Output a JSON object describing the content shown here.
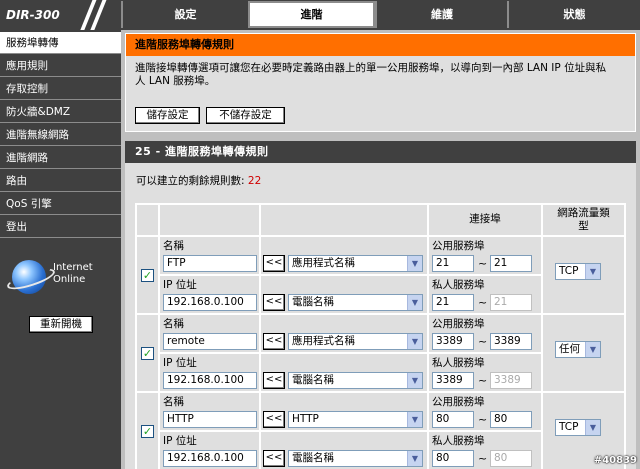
{
  "app": {
    "logo": "DIR-300"
  },
  "nav": {
    "tabs": [
      {
        "label": "設定"
      },
      {
        "label": "進階"
      },
      {
        "label": "維護"
      },
      {
        "label": "狀態"
      }
    ]
  },
  "sidebar": {
    "items": [
      {
        "label": "服務埠轉傳"
      },
      {
        "label": "應用規則"
      },
      {
        "label": "存取控制"
      },
      {
        "label": "防火牆&DMZ"
      },
      {
        "label": "進階無線網路"
      },
      {
        "label": "進階網路"
      },
      {
        "label": "路由"
      },
      {
        "label": "QoS 引擎"
      },
      {
        "label": "登出"
      }
    ],
    "internet_status_line1": "Internet",
    "internet_status_line2": "Online",
    "reboot_label": "重新開機"
  },
  "intro": {
    "title": "進階服務埠轉傳規則",
    "description": "進階接埠轉傳選項可讓您在必要時定義路由器上的單一公用服務埠，以導向到一內部 LAN IP 位址與私人 LAN 服務埠。",
    "save_label": "儲存設定",
    "dont_save_label": "不儲存設定"
  },
  "rules": {
    "title": "25 - 進階服務埠轉傳規則",
    "remaining_label": "可以建立的剩餘規則數:",
    "remaining_count": "22",
    "header_port": "連接埠",
    "header_traffic_line1": "網路流量類",
    "header_traffic_line2": "型",
    "name_label": "名稱",
    "ip_label": "IP 位址",
    "public_port_label": "公用服務埠",
    "private_port_label": "私人服務埠",
    "copy_button": "<<",
    "tilde": "~",
    "rows": [
      {
        "checked": "✓",
        "name": "FTP",
        "app_select": "應用程式名稱",
        "ip": "192.168.0.100",
        "computer_select": "電腦名稱",
        "public_start": "21",
        "public_end": "21",
        "private_start": "21",
        "private_end": "21",
        "traffic": "TCP"
      },
      {
        "checked": "✓",
        "name": "remote",
        "app_select": "應用程式名稱",
        "ip": "192.168.0.100",
        "computer_select": "電腦名稱",
        "public_start": "3389",
        "public_end": "3389",
        "private_start": "3389",
        "private_end": "3389",
        "traffic": "任何"
      },
      {
        "checked": "✓",
        "name": "HTTP",
        "app_select": "HTTP",
        "ip": "192.168.0.100",
        "computer_select": "電腦名稱",
        "public_start": "80",
        "public_end": "80",
        "private_start": "80",
        "private_end": "80",
        "traffic": "TCP"
      }
    ]
  },
  "watermark": "#40839"
}
